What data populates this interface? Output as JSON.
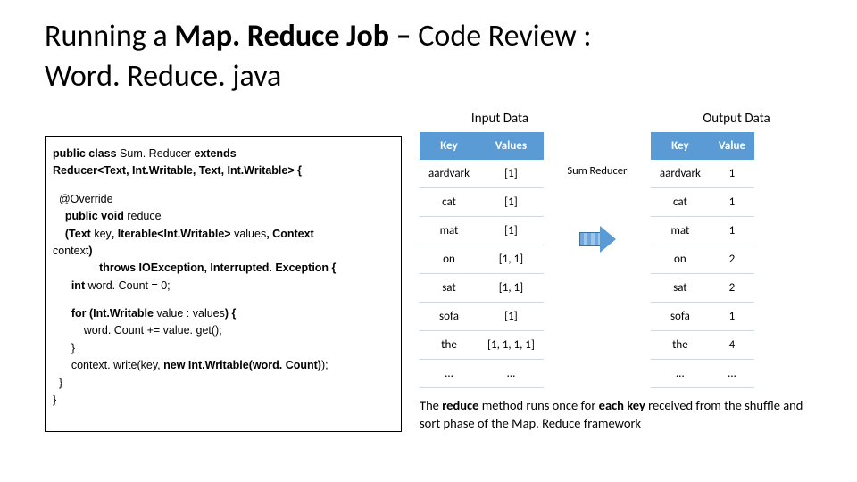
{
  "title": {
    "pre": "Running a ",
    "bold1": "Map. Reduce Job – ",
    "post": "Code Review :",
    "subtitle": "Word. Reduce. java"
  },
  "code": {
    "line1a": "public class ",
    "line1b": "Sum. Reducer ",
    "line1c": "extends",
    "line2": "Reducer<Text, Int.Writable, Text, Int.Writable> {",
    "line3": "  @Override",
    "line4a": "    public void ",
    "line4b": "reduce",
    "line5a": "    (Text ",
    "line5b": "key",
    "line5c": ", Iterable<Int.Writable> ",
    "line5d": "values",
    "line5e": ", Context",
    "line6a": "context",
    "line6b": ")",
    "line7": "               throws IOException, Interrupted. Exception {",
    "line8a": "      int ",
    "line8b": "word. Count = 0;",
    "line9a": "      for (Int.Writable ",
    "line9b": "value : values",
    "line9c": ") {",
    "line10": "          word. Count += value. get();",
    "line11": "      }",
    "line12a": "      context. write(key, ",
    "line12b": "new Int.Writable(word. Count)",
    "line12c": ");",
    "line13": "  }",
    "line14": "}"
  },
  "labels": {
    "input": "Input Data",
    "output": "Output Data",
    "mid": "Sum Reducer"
  },
  "input_table": {
    "h1": "Key",
    "h2": "Values",
    "rows": [
      {
        "k": "aardvark",
        "v": "[1]"
      },
      {
        "k": "cat",
        "v": "[1]"
      },
      {
        "k": "mat",
        "v": "[1]"
      },
      {
        "k": "on",
        "v": "[1, 1]"
      },
      {
        "k": "sat",
        "v": "[1, 1]"
      },
      {
        "k": "sofa",
        "v": "[1]"
      },
      {
        "k": "the",
        "v": "[1, 1, 1, 1]"
      },
      {
        "k": "…",
        "v": "…"
      }
    ]
  },
  "output_table": {
    "h1": "Key",
    "h2": "Value",
    "rows": [
      {
        "k": "aardvark",
        "v": "1"
      },
      {
        "k": "cat",
        "v": "1"
      },
      {
        "k": "mat",
        "v": "1"
      },
      {
        "k": "on",
        "v": "2"
      },
      {
        "k": "sat",
        "v": "2"
      },
      {
        "k": "sofa",
        "v": "1"
      },
      {
        "k": "the",
        "v": "4"
      },
      {
        "k": "…",
        "v": "…"
      }
    ]
  },
  "caption": {
    "a": "The ",
    "b1": "reduce ",
    "c": "method runs once for ",
    "b2": "each key ",
    "d": "received from the shuffle and sort phase of the Map. Reduce framework"
  }
}
